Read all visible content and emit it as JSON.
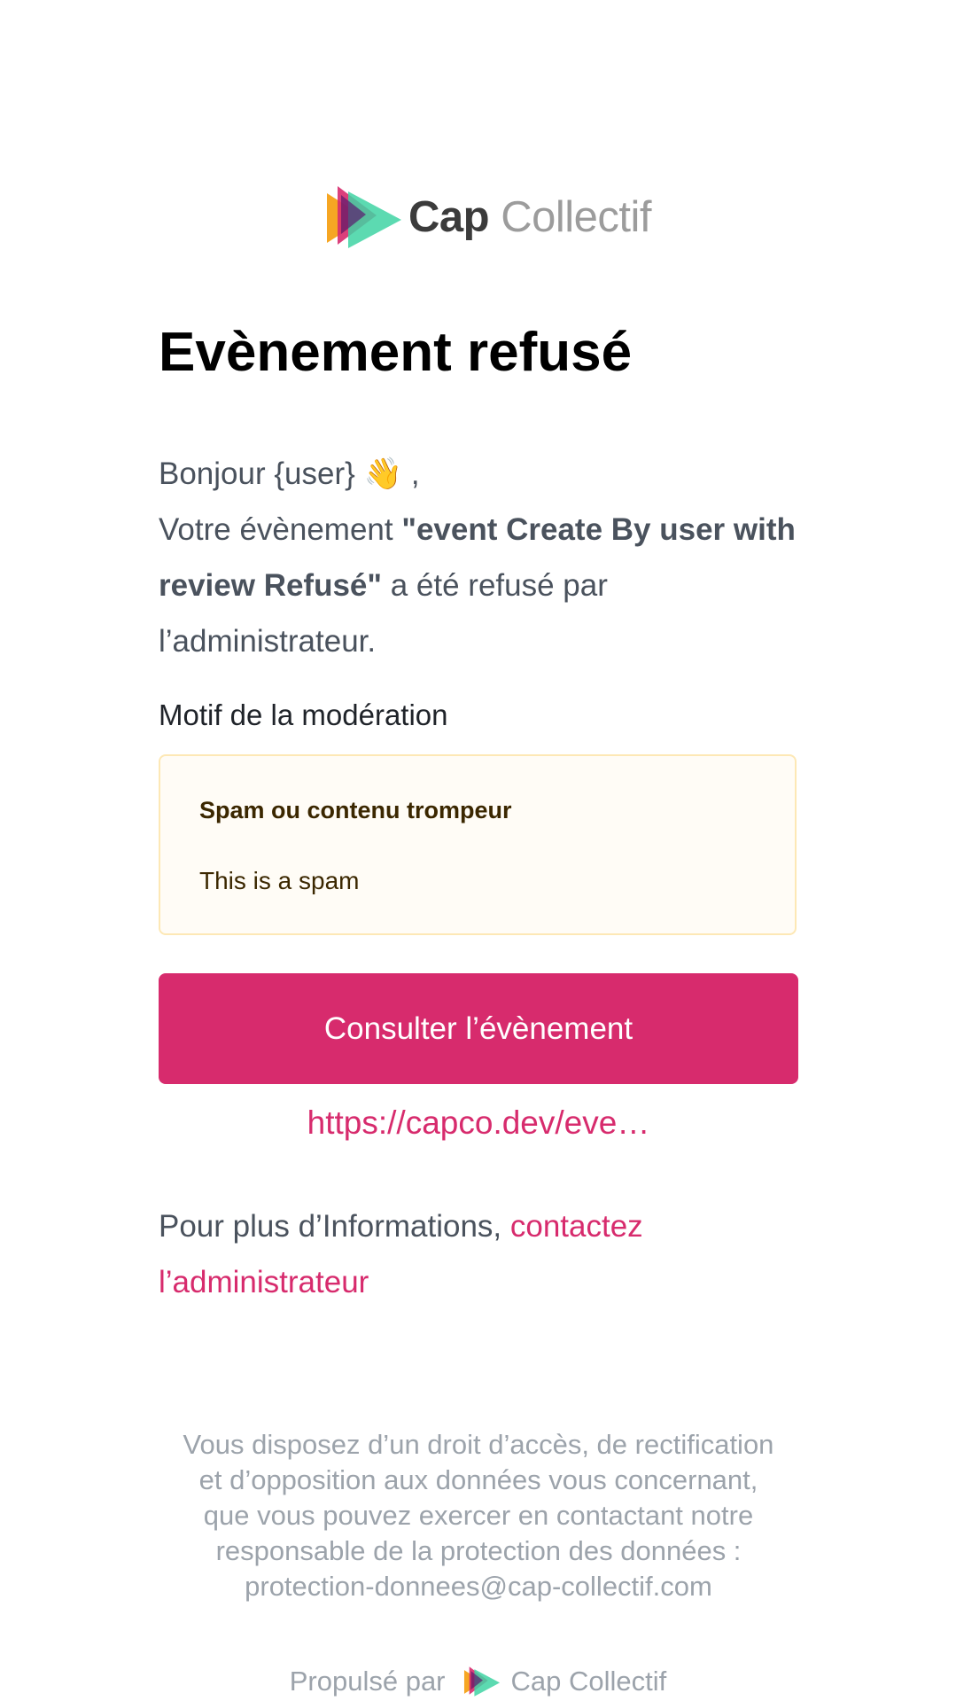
{
  "brand": {
    "logo_cap": "Cap",
    "logo_collectif": "Collectif",
    "logo_icon": "cap-collectif-triangle-logo"
  },
  "title": "Evènement refusé",
  "greeting": {
    "text": "Bonjour {user}",
    "emoji": "👋",
    "comma": " ,"
  },
  "message": {
    "prefix": "Votre évènement ",
    "event_name": "\"event Create By user with review Refusé\"",
    "suffix": " a été refusé par l’administrateur."
  },
  "moderation": {
    "label": "Motif de la modération",
    "reason": "Spam ou contenu trompeur",
    "comment": "This is a spam"
  },
  "cta": {
    "label": "Consulter l’évènement"
  },
  "link": {
    "url_text": "https://capco.dev/eve…"
  },
  "info": {
    "prefix": "Pour plus d’Informations, ",
    "link_text": "contactez l’administrateur"
  },
  "footer": {
    "legal": "Vous disposez d’un droit d’accès, de rectification et d’opposition aux données vous concernant, que vous pouvez exercer en contactant notre responsable de la protection des données : protection-donnees@cap-collectif.com",
    "powered_by": "Propulsé par",
    "powered_brand": "Cap Collectif"
  },
  "colors": {
    "accent": "#d72b6d",
    "text": "#4a525d",
    "title": "#000000",
    "muted": "#9ca3ab",
    "motif_bg": "#fffcf6",
    "motif_border": "#fde8b5"
  }
}
